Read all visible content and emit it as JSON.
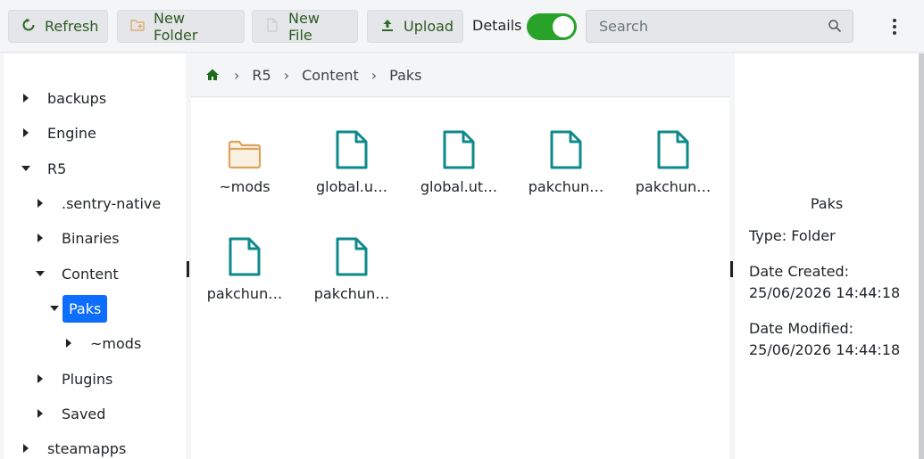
{
  "toolbar": {
    "refresh_label": "Refresh",
    "new_folder_label": "New Folder",
    "new_file_label": "New File",
    "upload_label": "Upload",
    "details_label": "Details",
    "details_on": true,
    "search_placeholder": "Search"
  },
  "sidebar": {
    "items": [
      {
        "label": "backups",
        "expanded": false
      },
      {
        "label": "Engine",
        "expanded": false
      },
      {
        "label": "R5",
        "expanded": true
      },
      {
        "label": ".sentry-native",
        "expanded": false
      },
      {
        "label": "Binaries",
        "expanded": false
      },
      {
        "label": "Content",
        "expanded": true
      },
      {
        "label": "Paks",
        "expanded": true,
        "selected": true
      },
      {
        "label": "~mods",
        "expanded": false
      },
      {
        "label": "Plugins",
        "expanded": false
      },
      {
        "label": "Saved",
        "expanded": false
      },
      {
        "label": "steamapps",
        "expanded": false
      }
    ]
  },
  "breadcrumb": [
    "R5",
    "Content",
    "Paks"
  ],
  "files": [
    {
      "name": "~mods",
      "type": "folder"
    },
    {
      "name": "global.u…",
      "type": "file"
    },
    {
      "name": "global.ut…",
      "type": "file"
    },
    {
      "name": "pakchun…",
      "type": "file"
    },
    {
      "name": "pakchun…",
      "type": "file"
    },
    {
      "name": "pakchun…",
      "type": "file"
    },
    {
      "name": "pakchun…",
      "type": "file"
    }
  ],
  "details": {
    "title": "Paks",
    "type_line": "Type: Folder",
    "created_label": "Date Created:",
    "created_value": "25/06/2026 14:44:18",
    "modified_label": "Date Modified:",
    "modified_value": "25/06/2026 14:44:18"
  },
  "colors": {
    "accent_green": "#28a228",
    "selection_blue": "#0d6efd",
    "file_icon": "#0e8a8a",
    "folder_icon": "#d9a45c"
  },
  "icons": {
    "refresh": "refresh-icon",
    "new_folder": "new-folder-icon",
    "new_file": "new-file-icon",
    "upload": "upload-icon",
    "search": "search-icon",
    "more": "more-vertical-icon",
    "home": "home-icon"
  }
}
